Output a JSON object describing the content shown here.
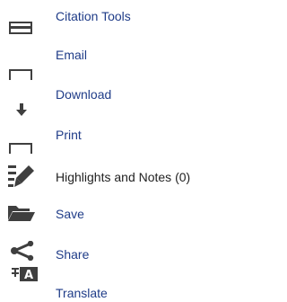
{
  "tools": {
    "items": [
      {
        "label": "Citation Tools",
        "icon": "citation-icon"
      },
      {
        "label": "Email",
        "icon": "email-icon"
      },
      {
        "label": "Download",
        "icon": "download-icon"
      },
      {
        "label": "Print",
        "icon": "print-icon"
      },
      {
        "label": "Highlights and Notes (0)",
        "icon": "highlight-icon"
      },
      {
        "label": "Save",
        "icon": "folder-icon"
      },
      {
        "label": "Share",
        "icon": "share-icon"
      },
      {
        "label": "Translate",
        "icon": "translate-icon"
      }
    ]
  },
  "colors": {
    "link": "#1f3c88",
    "text": "#222222",
    "icon": "#3f3f3f"
  }
}
